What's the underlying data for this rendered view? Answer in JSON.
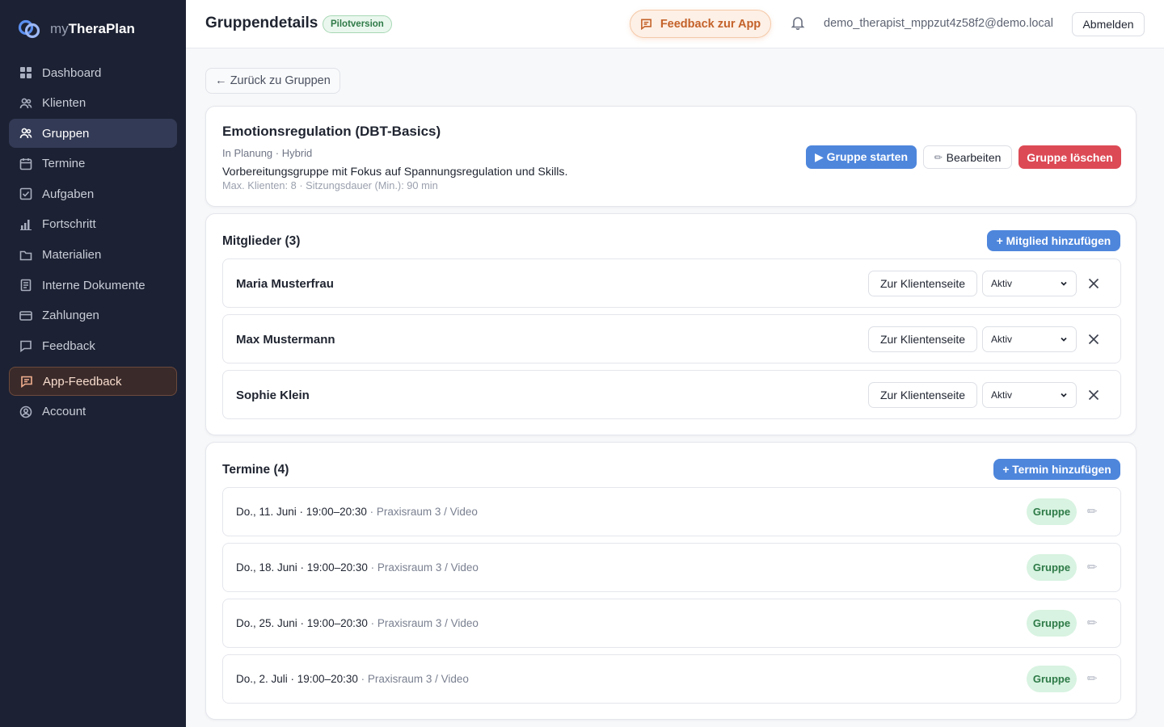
{
  "app": {
    "name_prefix": "my",
    "name_main": "TheraPlan"
  },
  "sidebar": {
    "items": [
      {
        "label": "Dashboard",
        "icon": "grid-icon"
      },
      {
        "label": "Klienten",
        "icon": "users-icon"
      },
      {
        "label": "Gruppen",
        "icon": "users-icon",
        "active": true
      },
      {
        "label": "Termine",
        "icon": "calendar-icon"
      },
      {
        "label": "Aufgaben",
        "icon": "checkbox-icon"
      },
      {
        "label": "Fortschritt",
        "icon": "bar-chart-icon"
      },
      {
        "label": "Materialien",
        "icon": "folder-icon"
      },
      {
        "label": "Interne Dokumente",
        "icon": "document-icon"
      },
      {
        "label": "Zahlungen",
        "icon": "credit-card-icon"
      },
      {
        "label": "Feedback",
        "icon": "message-icon"
      },
      {
        "label": "App-Feedback",
        "icon": "message-icon",
        "highlighted": true
      },
      {
        "label": "Account",
        "icon": "user-circle-icon"
      }
    ]
  },
  "header": {
    "title": "Gruppendetails",
    "badge": "Pilotversion",
    "feedback_button": "Feedback zur App",
    "user_email": "demo_therapist_mppzut4z58f2@demo.local",
    "logout": "Abmelden"
  },
  "back_button": "← Zurück zu Gruppen",
  "group": {
    "name": "Emotionsregulation (DBT-Basics)",
    "meta": "In Planung · Hybrid",
    "description": "Vorbereitungsgruppe mit Fokus auf Spannungsregulation und Skills.",
    "details": "Max. Klienten: 8 · Sitzungsdauer (Min.): 90 min",
    "start_button": "▶ Gruppe starten",
    "edit_button": "Bearbeiten",
    "delete_button": "Gruppe löschen"
  },
  "members": {
    "title": "Mitglieder (3)",
    "add_button": "+ Mitglied hinzufügen",
    "client_page_button": "Zur Klientenseite",
    "list": [
      {
        "name": "Maria Musterfrau",
        "status": "Aktiv"
      },
      {
        "name": "Max Mustermann",
        "status": "Aktiv"
      },
      {
        "name": "Sophie Klein",
        "status": "Aktiv"
      }
    ]
  },
  "appointments": {
    "title": "Termine (4)",
    "add_button": "+ Termin hinzufügen",
    "list": [
      {
        "when": "Do., 11. Juni · 19:00–20:30",
        "where": " · Praxisraum 3 / Video",
        "type": "Gruppe"
      },
      {
        "when": "Do., 18. Juni · 19:00–20:30",
        "where": " · Praxisraum 3 / Video",
        "type": "Gruppe"
      },
      {
        "when": "Do., 25. Juni · 19:00–20:30",
        "where": " · Praxisraum 3 / Video",
        "type": "Gruppe"
      },
      {
        "when": "Do., 2. Juli · 19:00–20:30",
        "where": " · Praxisraum 3 / Video",
        "type": "Gruppe"
      }
    ]
  },
  "colors": {
    "sidebar_bg": "#1c2133",
    "primary": "#4e86dc",
    "danger": "#dc4a55",
    "badge_green": "#d8f3e1",
    "feedback_accent": "#c4622a"
  }
}
